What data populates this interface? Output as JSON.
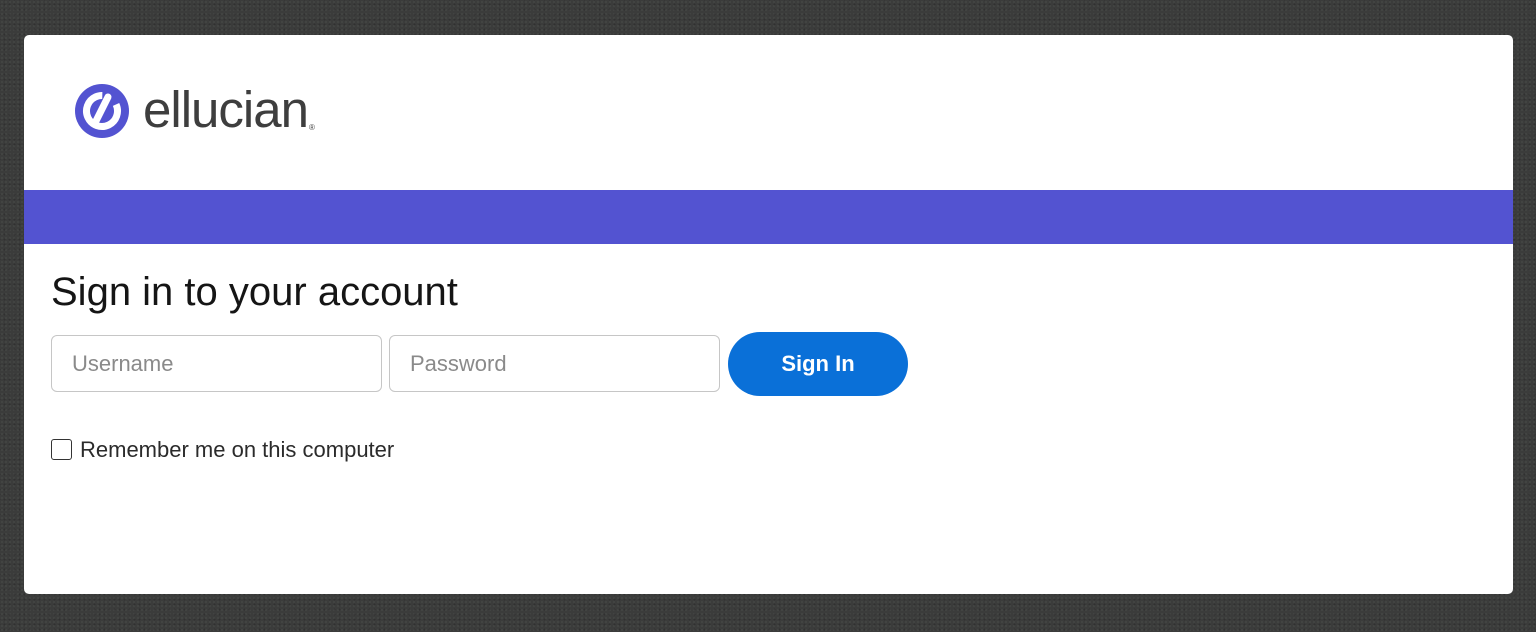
{
  "header": {
    "logo_text": "ellucian",
    "logo_trademark": "®"
  },
  "login": {
    "title": "Sign in to your account",
    "username": {
      "value": "",
      "placeholder": "Username"
    },
    "password": {
      "value": "",
      "placeholder": "Password"
    },
    "submit_label": "Sign In",
    "remember": {
      "label": "Remember me on this computer",
      "checked": false
    }
  },
  "colors": {
    "brand_purple": "#5353d1",
    "button_blue": "#0a70d8",
    "page_background": "#3b3c3b",
    "card_background": "#ffffff"
  },
  "icons": {
    "logo_mark": "ellucian-logo-icon"
  }
}
